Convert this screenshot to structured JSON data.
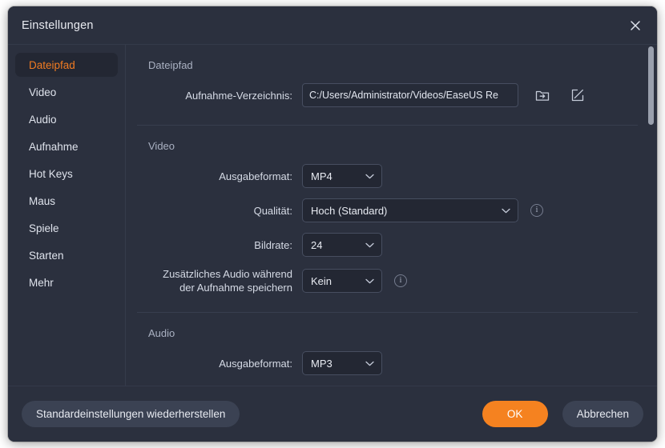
{
  "window": {
    "title": "Einstellungen",
    "close_icon": "close-icon"
  },
  "sidebar": {
    "items": [
      {
        "label": "Dateipfad",
        "active": true
      },
      {
        "label": "Video",
        "active": false
      },
      {
        "label": "Audio",
        "active": false
      },
      {
        "label": "Aufnahme",
        "active": false
      },
      {
        "label": "Hot Keys",
        "active": false
      },
      {
        "label": "Maus",
        "active": false
      },
      {
        "label": "Spiele",
        "active": false
      },
      {
        "label": "Starten",
        "active": false
      },
      {
        "label": "Mehr",
        "active": false
      }
    ]
  },
  "sections": {
    "filepath": {
      "title": "Dateipfad",
      "record_dir_label": "Aufnahme-Verzeichnis:",
      "record_dir_value": "C:/Users/Administrator/Videos/EaseUS Re",
      "record_dir_placeholder": "C:/Users/Administrator/Videos",
      "browse_icon": "folder-open-icon",
      "edit_icon": "edit-pencil-icon"
    },
    "video": {
      "title": "Video",
      "format_label": "Ausgabeformat:",
      "format_value": "MP4",
      "quality_label": "Qualität:",
      "quality_value": "Hoch (Standard)",
      "quality_info_icon": "info-icon",
      "framerate_label": "Bildrate:",
      "framerate_value": "24",
      "extra_audio_label_line1": "Zusätzliches Audio während",
      "extra_audio_label_line2": "der Aufnahme speichern",
      "extra_audio_value": "Kein",
      "extra_audio_info_icon": "info-icon"
    },
    "audio": {
      "title": "Audio",
      "format_label": "Ausgabeformat:",
      "format_value": "MP3"
    }
  },
  "footer": {
    "restore_defaults": "Standardeinstellungen wiederherstellen",
    "ok": "OK",
    "cancel": "Abbrechen"
  },
  "colors": {
    "accent": "#f58220",
    "dialog_bg": "#2b303e",
    "field_bg": "#232733",
    "text": "#e8ebf2",
    "muted_text": "#aab1c2"
  }
}
